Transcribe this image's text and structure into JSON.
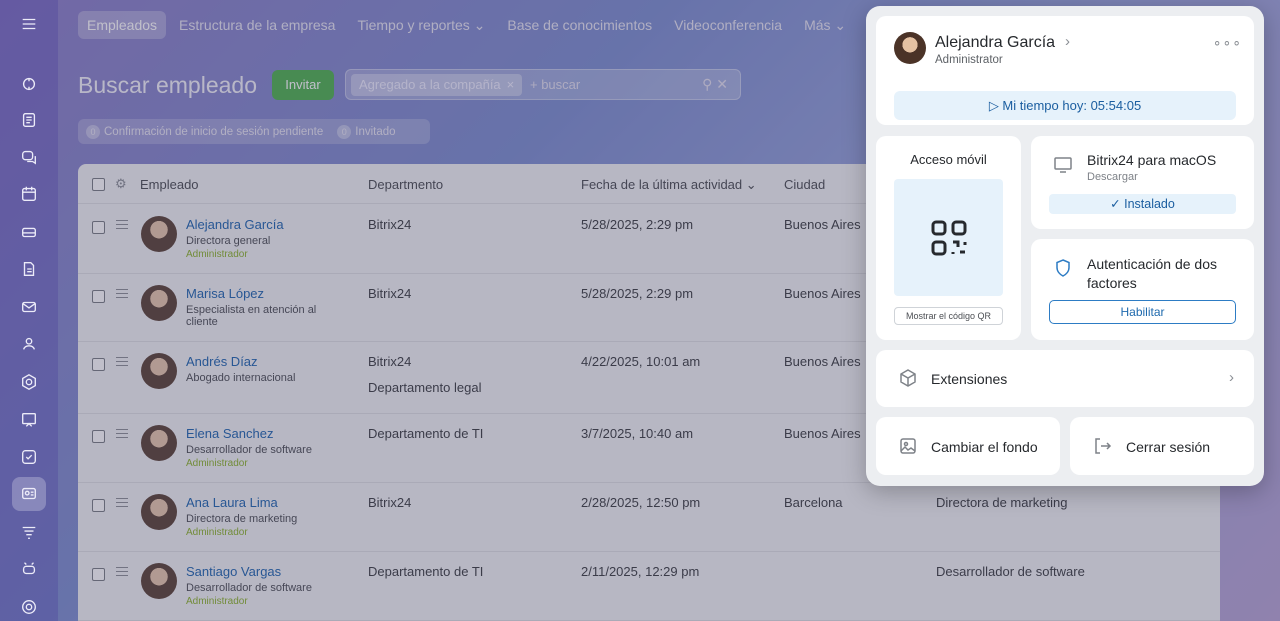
{
  "nav": {
    "tabs": [
      "Empleados",
      "Estructura de la empresa",
      "Tiempo y reportes ⌄",
      "Base de conocimientos",
      "Videoconferencia",
      "Más ⌄"
    ]
  },
  "page": {
    "title": "Buscar empleado",
    "invite_label": "Invitar",
    "search_chip": "Agregado a la compañía",
    "search_placeholder": "+ buscar",
    "filter_pending_count": "0",
    "filter_pending_label": "Confirmación de inicio de sesión pendiente",
    "filter_invited_count": "0",
    "filter_invited_label": "Invitado"
  },
  "table": {
    "headers": {
      "employee": "Empleado",
      "department": "Departmento",
      "last_activity": "Fecha de la última actividad ⌄",
      "city": "Ciudad"
    },
    "rows": [
      {
        "name": "Alejandra García",
        "role": "Directora general",
        "admin": "Administrador",
        "dept": "Bitrix24",
        "dept2": "",
        "date": "5/28/2025, 2:29 pm",
        "city": "Buenos Aires",
        "position": ""
      },
      {
        "name": "Marisa López",
        "role": "Especialista en atención al cliente",
        "admin": "",
        "dept": "Bitrix24",
        "dept2": "",
        "date": "5/28/2025, 2:29 pm",
        "city": "Buenos Aires",
        "position": ""
      },
      {
        "name": "Andrés Díaz",
        "role": "Abogado internacional",
        "admin": "",
        "dept": "Bitrix24",
        "dept2": "Departamento legal",
        "date": "4/22/2025, 10:01 am",
        "city": "Buenos Aires",
        "position": ""
      },
      {
        "name": "Elena Sanchez",
        "role": "Desarrollador de software",
        "admin": "Administrador",
        "dept": "Departamento de TI",
        "dept2": "",
        "date": "3/7/2025, 10:40 am",
        "city": "Buenos Aires",
        "position": ""
      },
      {
        "name": "Ana Laura Lima",
        "role": "Directora de marketing",
        "admin": "Administrador",
        "dept": "Bitrix24",
        "dept2": "",
        "date": "2/28/2025, 12:50 pm",
        "city": "Barcelona",
        "position": "Directora de marketing"
      },
      {
        "name": "Santiago Vargas",
        "role": "Desarrollador de software",
        "admin": "Administrador",
        "dept": "Departamento de TI",
        "dept2": "",
        "date": "2/11/2025, 12:29 pm",
        "city": "",
        "position": "Desarrollador de software"
      }
    ]
  },
  "profile": {
    "name": "Alejandra García",
    "role": "Administrator",
    "time_label": "▷ Mi tiempo hoy: 05:54:05",
    "mobile_title": "Acceso móvil",
    "qr_button": "Mostrar el código QR",
    "mac_title": "Bitrix24 para macOS",
    "mac_sub": "Descargar",
    "mac_installed": "✓ Instalado",
    "twofa_title": "Autenticación de dos factores",
    "twofa_button": "Habilitar",
    "extensions": "Extensiones",
    "change_bg": "Cambiar el fondo",
    "logout": "Cerrar sesión"
  }
}
